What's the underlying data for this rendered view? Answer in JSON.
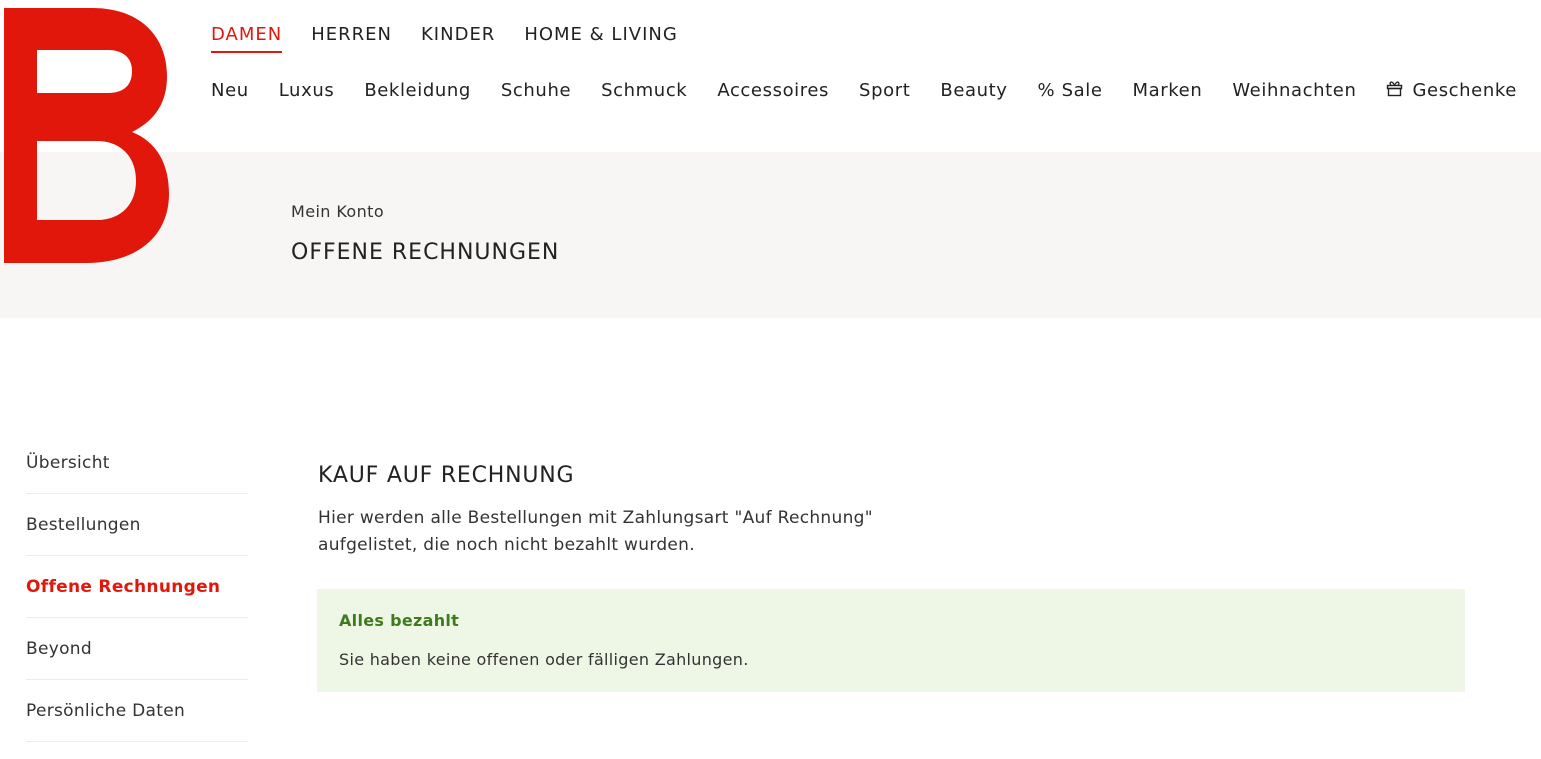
{
  "brand": {
    "accent_color": "#e2170b",
    "logo_icon": "brand-b-logo"
  },
  "gender_nav": [
    {
      "label": "DAMEN",
      "active": true
    },
    {
      "label": "HERREN",
      "active": false
    },
    {
      "label": "KINDER",
      "active": false
    },
    {
      "label": "HOME & LIVING",
      "active": false
    }
  ],
  "category_nav": [
    {
      "label": "Neu"
    },
    {
      "label": "Luxus"
    },
    {
      "label": "Bekleidung"
    },
    {
      "label": "Schuhe"
    },
    {
      "label": "Schmuck"
    },
    {
      "label": "Accessoires"
    },
    {
      "label": "Sport"
    },
    {
      "label": "Beauty"
    },
    {
      "label": "% Sale"
    },
    {
      "label": "Marken"
    },
    {
      "label": "Weihnachten"
    },
    {
      "label": "Geschenke",
      "icon": "gift-icon"
    }
  ],
  "hero": {
    "breadcrumb": "Mein Konto",
    "title": "OFFENE RECHNUNGEN"
  },
  "side_nav": [
    {
      "label": "Übersicht",
      "active": false
    },
    {
      "label": "Bestellungen",
      "active": false
    },
    {
      "label": "Offene Rechnungen",
      "active": true
    },
    {
      "label": "Beyond",
      "active": false
    },
    {
      "label": "Persönliche Daten",
      "active": false
    }
  ],
  "main": {
    "heading": "KAUF AUF RECHNUNG",
    "description": "Hier werden alle Bestellungen mit Zahlungsart \"Auf Rechnung\" aufgelistet, die noch nicht bezahlt wurden.",
    "alert": {
      "title": "Alles bezahlt",
      "text": "Sie haben keine offenen oder fälligen Zahlungen.",
      "background": "#eef7e6",
      "title_color": "#3f7a1e"
    }
  }
}
